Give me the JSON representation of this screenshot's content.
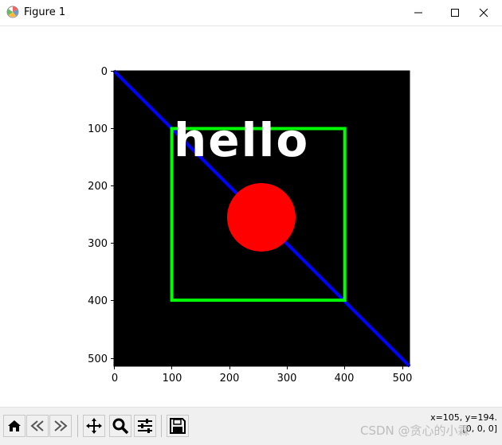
{
  "window": {
    "title": "Figure 1",
    "minimize_glyph": "—",
    "maximize_glyph": "☐",
    "close_glyph": "✕"
  },
  "plot": {
    "x_ticks": [
      "0",
      "100",
      "200",
      "300",
      "400",
      "500"
    ],
    "y_ticks": [
      "0",
      "100",
      "200",
      "300",
      "400",
      "500"
    ],
    "image_text": "hello",
    "background_color": "#000000",
    "line_color": "#0000ff",
    "rect_color": "#00ff00",
    "circle_color": "#ff0000",
    "text_color": "#ffffff"
  },
  "toolbar": {
    "icons": [
      "home-icon",
      "back-icon",
      "forward-icon",
      "pan-icon",
      "zoom-icon",
      "configure-subplots-icon",
      "save-icon"
    ],
    "coord_readout": "x=105, y=194.",
    "pixel_value": "[0, 0, 0]"
  },
  "watermark": "CSDN @贪心的小霖"
}
